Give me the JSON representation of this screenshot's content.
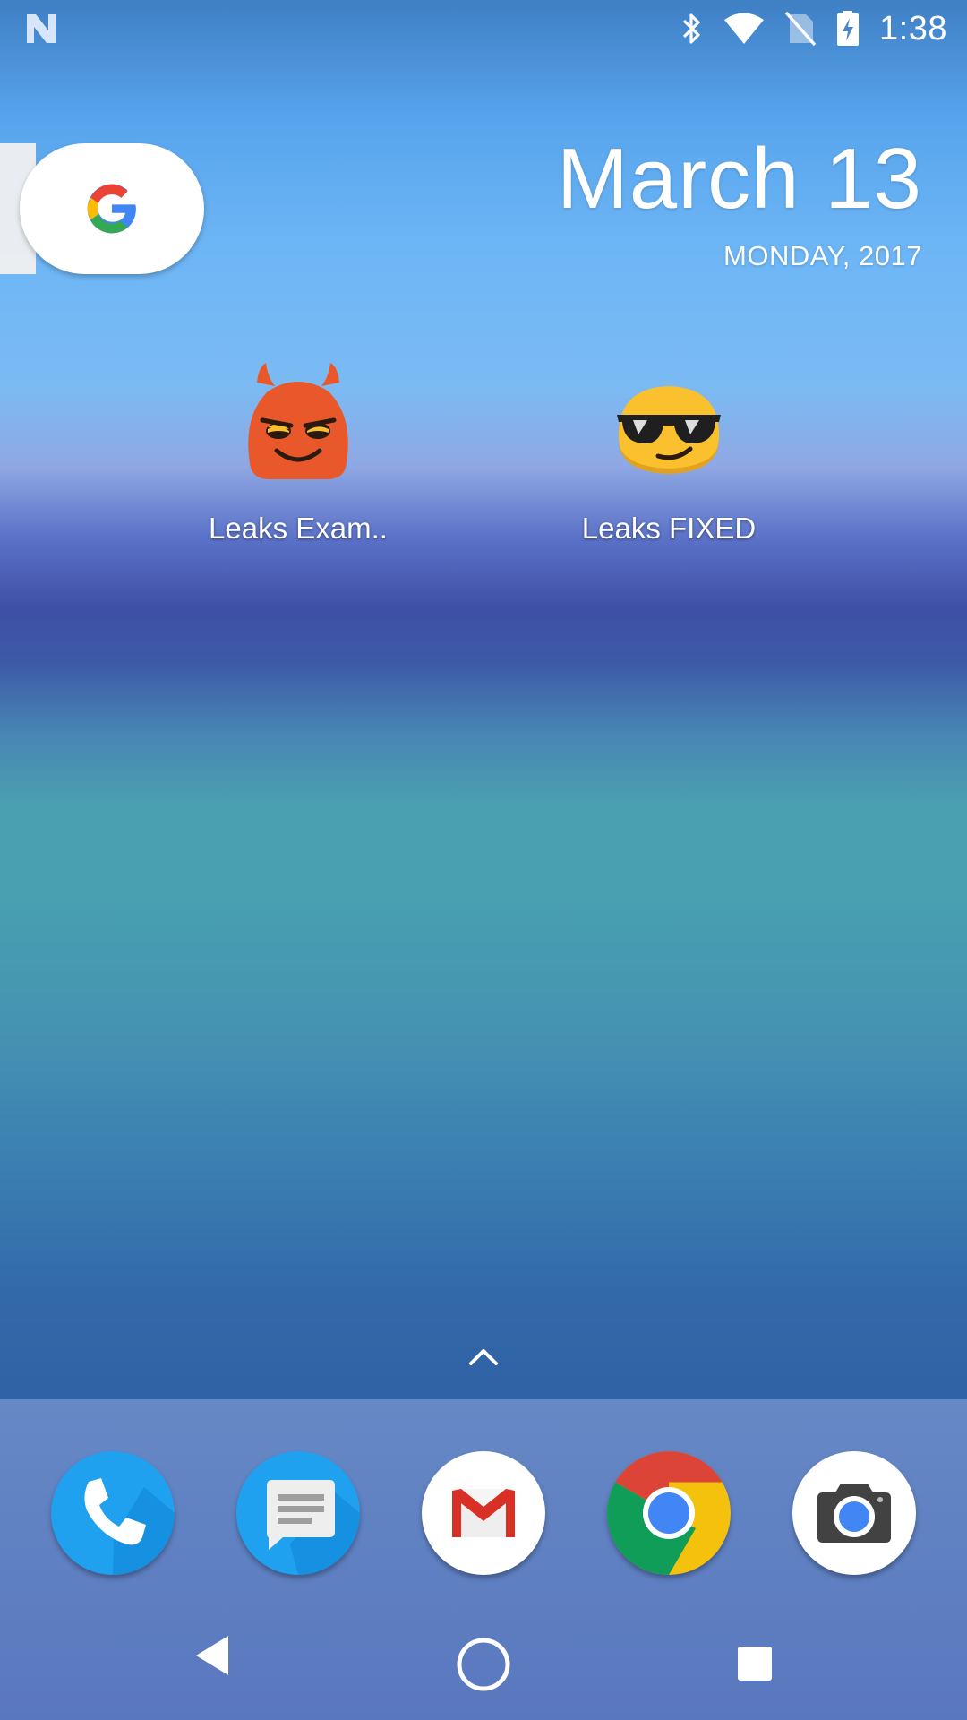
{
  "status_bar": {
    "time": "1:38",
    "icons": [
      "n-notification-icon",
      "bluetooth-icon",
      "wifi-icon",
      "no-sim-icon",
      "battery-charging-icon"
    ]
  },
  "search_widget": {
    "icon": "google-g-icon"
  },
  "date_widget": {
    "date": "March 13",
    "day_year": "MONDAY, 2017"
  },
  "home_apps": [
    {
      "label": "Leaks Exam..",
      "icon": "devil-emoji-icon"
    },
    {
      "label": "Leaks FIXED",
      "icon": "sunglasses-emoji-icon"
    }
  ],
  "dock": {
    "apps": [
      {
        "name": "Phone",
        "icon": "phone-icon"
      },
      {
        "name": "Messages",
        "icon": "messages-icon"
      },
      {
        "name": "Gmail",
        "icon": "gmail-icon"
      },
      {
        "name": "Chrome",
        "icon": "chrome-icon"
      },
      {
        "name": "Camera",
        "icon": "camera-icon"
      }
    ]
  },
  "nav_bar": {
    "buttons": [
      "back-icon",
      "home-icon",
      "recents-icon"
    ]
  },
  "colors": {
    "devil_orange": "#e8582b",
    "emoji_yellow": "#fbc02d",
    "phone_blue": "#1fa1f0",
    "gmail_red": "#d93025",
    "chrome_red": "#db4437",
    "chrome_green": "#0f9d58",
    "chrome_yellow": "#f4c20d",
    "chrome_blue": "#4285f4"
  }
}
